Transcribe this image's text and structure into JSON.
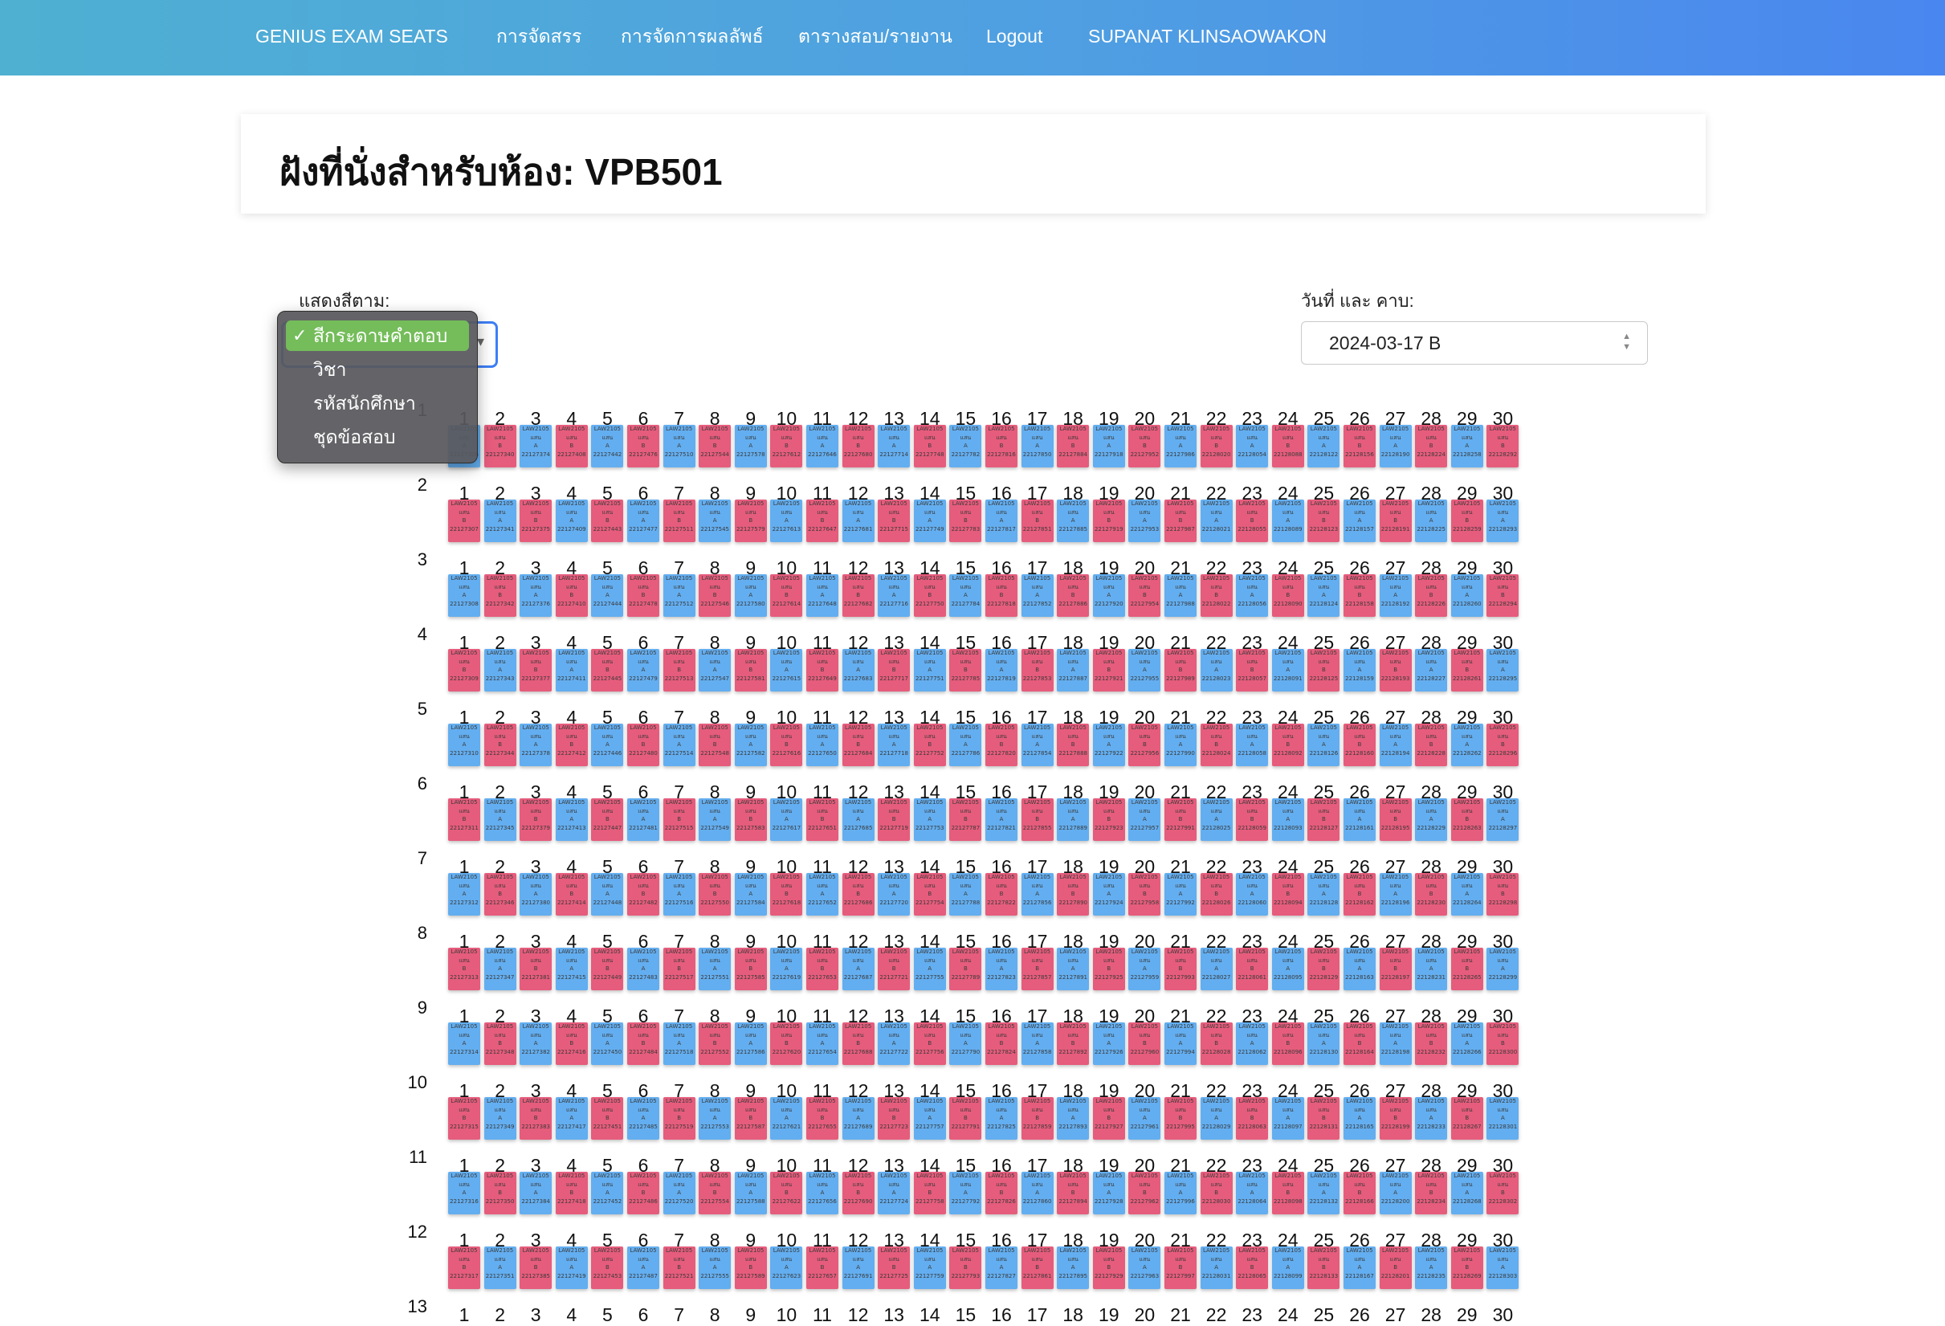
{
  "navbar": {
    "brand": "GENIUS EXAM SEATS",
    "items": [
      "การจัดสรร",
      "การจัดการผลลัพธ์",
      "ตารางสอบ/รายงาน",
      "Logout",
      "SUPANAT KLINSAOWAKON"
    ]
  },
  "page": {
    "title": "ฝังที่นั่งสำหรับห้อง: VPB501"
  },
  "filters": {
    "color_label": "แสดงสีตาม:",
    "date_label": "วันที่ และ คาบ:",
    "date_value": "2024-03-17 B",
    "color_options": [
      "สีกระดาษคำตอบ",
      "วิชา",
      "รหัสนักศึกษา",
      "ชุดข้อสอบ"
    ],
    "color_selected_index": 0
  },
  "colors": {
    "seat_blue": "#63aef0",
    "seat_red": "#e65c7c",
    "navbar_start": "#4fb0d2",
    "navbar_end": "#4a86ef",
    "dropdown_selected": "#74bd5a"
  },
  "icons": {
    "check": "check-icon",
    "chevron": "chevron-updown-icon"
  },
  "seating": {
    "course": "LAW2105",
    "seat_caption": "แสน",
    "rows_visible": [
      1,
      2,
      3,
      4,
      5,
      6,
      7,
      8,
      9,
      10,
      11,
      12,
      13
    ],
    "columns": [
      1,
      2,
      3,
      4,
      5,
      6,
      7,
      8,
      9,
      10,
      11,
      12,
      13,
      14,
      15,
      16,
      17,
      18,
      19,
      20,
      21,
      22,
      23,
      24,
      25,
      26,
      27,
      28,
      29,
      30
    ],
    "first_row_ids": [
      "22127306",
      "22127340",
      "22127374",
      "22127408",
      "22127442",
      "22127476",
      "22127510",
      "22127544",
      "22127578",
      "22127612",
      "22127646",
      "22127680",
      "22127714",
      "22127748",
      "22127782",
      "22127816",
      "22127850",
      "22127884",
      "22127918",
      "22127952",
      "22127986",
      "22128020",
      "22128054",
      "22128088",
      "22128122",
      "22128156",
      "22128190",
      "22128224",
      "22128258"
    ]
  }
}
